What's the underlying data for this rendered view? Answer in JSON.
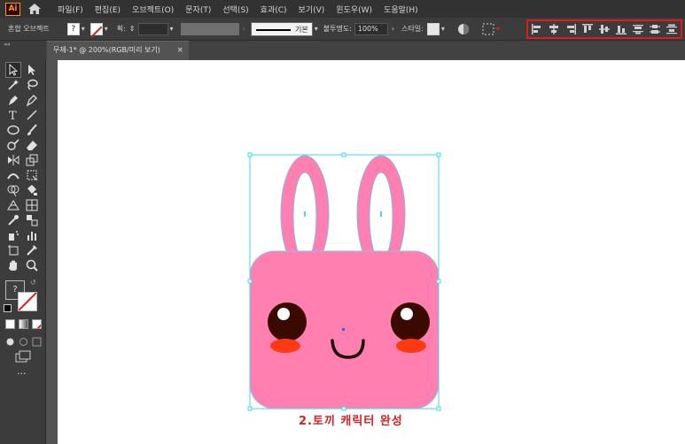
{
  "app": {
    "logo_text": "Ai"
  },
  "menu": [
    "파일(F)",
    "편집(E)",
    "오브젝트(O)",
    "문자(T)",
    "선택(S)",
    "효과(C)",
    "보기(V)",
    "윈도우(W)",
    "도움말(H)"
  ],
  "control_bar": {
    "object_type": "혼합 오브젝트",
    "fill_swatch": "?",
    "stroke_weight_label": "획:",
    "stroke_style": "기본",
    "opacity_label": "불투명도:",
    "opacity_value": "100%",
    "style_label": "스타일:"
  },
  "document_tab": {
    "title": "무제-1* @ 200%(RGB/미리 보기)",
    "close": "×"
  },
  "toolbar": {
    "more": "...",
    "fill_unknown": "?"
  },
  "artboard": {
    "caption": "2.토끼 캐릭터 완성"
  },
  "colors": {
    "accent_red": "#e01a1a",
    "character_pink": "#ff7fb0",
    "selection_cyan": "#3fd9f0"
  }
}
